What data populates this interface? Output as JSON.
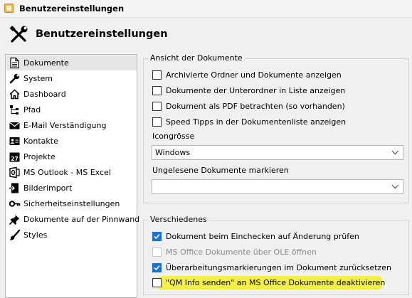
{
  "window": {
    "title": "Benutzereinstellungen",
    "app_icon": "folder-app-icon"
  },
  "header": {
    "title": "Benutzereinstellungen",
    "icon": "tools-icon"
  },
  "sidebar": {
    "items": [
      {
        "label": "Dokumente",
        "icon": "document-icon",
        "selected": true
      },
      {
        "label": "System",
        "icon": "wrench-icon",
        "selected": false
      },
      {
        "label": "Dashboard",
        "icon": "home-icon",
        "selected": false
      },
      {
        "label": "Pfad",
        "icon": "tree-icon",
        "selected": false
      },
      {
        "label": "E-Mail Verständigung",
        "icon": "mail-icon",
        "selected": false
      },
      {
        "label": "Kontakte",
        "icon": "contact-card-icon",
        "selected": false
      },
      {
        "label": "Projekte",
        "icon": "calendar-icon",
        "selected": false
      },
      {
        "label": "MS Outlook - MS Excel",
        "icon": "office-icon",
        "selected": false
      },
      {
        "label": "Bilderimport",
        "icon": "image-import-icon",
        "selected": false
      },
      {
        "label": "Sicherheitseinstellungen",
        "icon": "key-icon",
        "selected": false
      },
      {
        "label": "Dokumente auf der Pinnwand",
        "icon": "pin-icon",
        "selected": false
      },
      {
        "label": "Styles",
        "icon": "paintbrush-icon",
        "selected": false
      }
    ]
  },
  "ansicht": {
    "legend": "Ansicht der Dokumente",
    "options": [
      {
        "label": "Archivierte Ordner und Dokumente anzeigen",
        "checked": false
      },
      {
        "label": "Dokumente der Unterordner in Liste anzeigen",
        "checked": false
      },
      {
        "label": "Dokument als PDF betrachten (so vorhanden)",
        "checked": false
      },
      {
        "label": "Speed Tipps in der Dokumentenliste anzeigen",
        "checked": false
      }
    ],
    "icon_size_label": "Icongrösse",
    "icon_size_value": "Windows",
    "unread_label": "Ungelesene Dokumente markieren",
    "unread_value": ""
  },
  "verschiedenes": {
    "legend": "Verschiedenes",
    "options": [
      {
        "label": "Dokument beim Einchecken auf Änderung prüfen",
        "checked": true,
        "disabled": false
      },
      {
        "label": "MS Office Dokumente über OLE öffnen",
        "checked": false,
        "disabled": true
      },
      {
        "label": "Überarbeitungsmarkierungen im Dokument zurücksetzen",
        "checked": true,
        "disabled": false
      },
      {
        "label": "\"QM Info senden\" an MS Office Dokumente deaktivieren",
        "checked": false,
        "disabled": false,
        "highlighted": true
      }
    ]
  },
  "colors": {
    "accent": "#1f6fd1",
    "highlight": "#f2f047",
    "selection": "#e5e5e5"
  }
}
